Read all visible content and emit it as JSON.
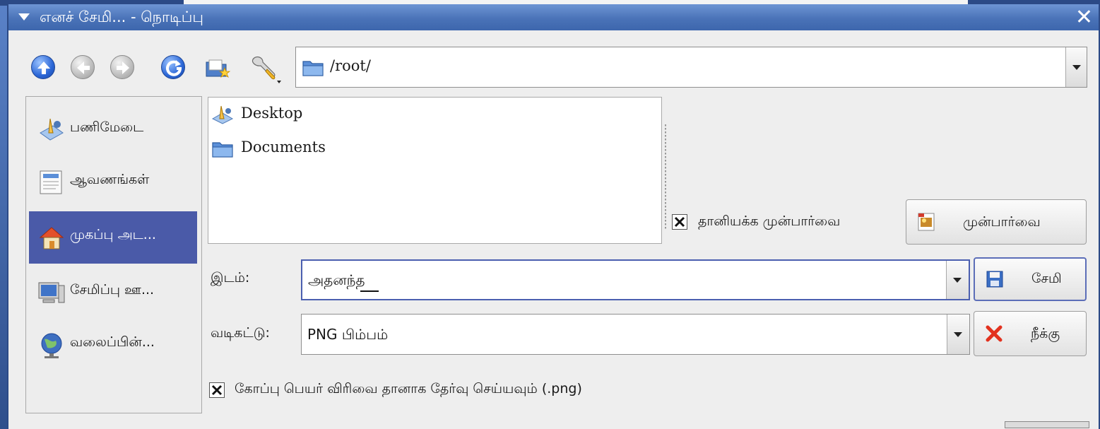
{
  "window": {
    "title": "எனச் சேமி... - நொடிப்பு",
    "close_glyph": "✕"
  },
  "toolbar": {
    "buttons": [
      {
        "name": "up",
        "icon": "arrow-up-icon"
      },
      {
        "name": "back",
        "icon": "arrow-left-icon"
      },
      {
        "name": "forward",
        "icon": "arrow-right-icon"
      },
      {
        "name": "reload",
        "icon": "reload-icon"
      },
      {
        "name": "new-folder",
        "icon": "new-folder-icon"
      },
      {
        "name": "options",
        "icon": "wrench-icon"
      }
    ],
    "path": "/root/"
  },
  "sidebar": {
    "items": [
      {
        "label": "பணிமேடை",
        "icon": "desktop-icon",
        "active": false
      },
      {
        "label": "ஆவணங்கள்",
        "icon": "documents-icon",
        "active": false
      },
      {
        "label": "முகப்பு அட...",
        "icon": "home-icon",
        "active": true
      },
      {
        "label": "சேமிப்பு ஊ...",
        "icon": "computer-icon",
        "active": false
      },
      {
        "label": "வலைப்பின்...",
        "icon": "network-icon",
        "active": false
      }
    ]
  },
  "files": [
    {
      "name": "Desktop",
      "icon": "desktop-folder-icon"
    },
    {
      "name": "Documents",
      "icon": "folder-icon"
    }
  ],
  "preview": {
    "auto_checkbox_label": "தானியக்க முன்பார்வை",
    "auto_checked": true,
    "button_label": "முன்பார்வை"
  },
  "location": {
    "label": "இடம்:",
    "value": "அதனந்த"
  },
  "filter": {
    "label": "வடிகட்டு:",
    "value": "PNG பிம்பம்"
  },
  "actions": {
    "save_label": "சேமி",
    "cancel_label": "நீக்கு"
  },
  "extension_checkbox": {
    "label": "கோப்பு பெயர் விரிவை தானாக தேர்வு செய்யவும் (.png)",
    "checked": true
  },
  "colors": {
    "titlebar": "#4a73b8",
    "selection": "#4a5aa8",
    "dialog_bg": "#eeeeee"
  }
}
